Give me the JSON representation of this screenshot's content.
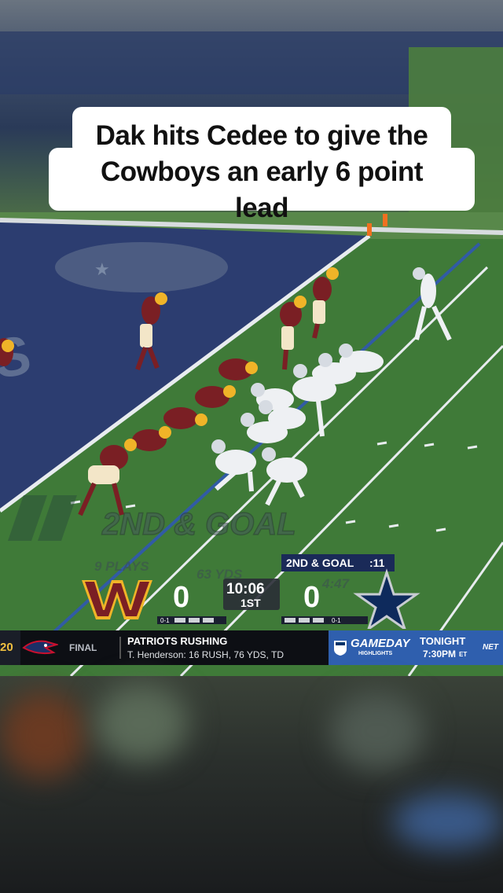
{
  "caption": {
    "text": "Dak hits Cedee to give the Cowboys an early 6 point lead"
  },
  "field": {
    "overlay_big": "2ND & GOAL",
    "overlay_plays": "9 PLAYS",
    "overlay_yds": "63 YDS",
    "overlay_time": "4:47"
  },
  "scorebug": {
    "down_distance": "2ND & GOAL",
    "play_clock": ":11",
    "away_score": "0",
    "home_score": "0",
    "game_clock": "10:06",
    "quarter": "1ST",
    "away_record": "0-1",
    "home_record": "0-1",
    "away_logo": "commanders-logo",
    "home_logo": "cowboys-star-logo"
  },
  "ticker": {
    "score_fragment": "20",
    "team_logo": "patriots-logo",
    "status": "FINAL",
    "headline": "PATRIOTS RUSHING",
    "detail": "T. Henderson: 16 RUSH, 76 YDS, TD",
    "promo_brand": "GAMEDAY",
    "promo_sub": "HIGHLIGHTS",
    "promo_when": "TONIGHT",
    "promo_time": "7:30PM",
    "promo_tz": "ET",
    "network": "NET"
  },
  "colors": {
    "endzone": "#2c3d70",
    "field": "#3f7a38",
    "commanders_burgundy": "#7a1f24",
    "commanders_gold": "#f0b428",
    "cowboys_navy": "#0e2a5c",
    "scorebug_dark": "#1a2030",
    "ticker_blue": "#2f5fae"
  }
}
